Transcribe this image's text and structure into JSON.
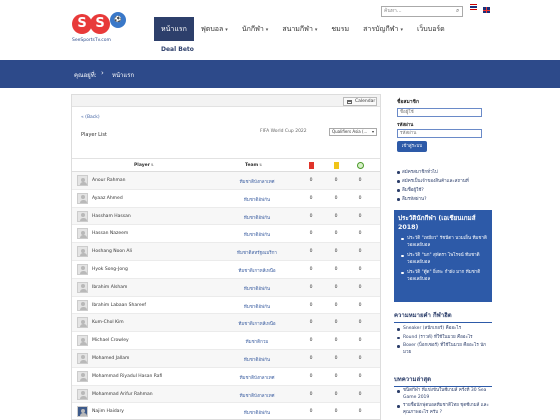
{
  "header": {
    "logo": {
      "letters": [
        "S",
        "S"
      ],
      "tagline": "SeeSportsTv.com"
    },
    "nav": [
      {
        "label": "หน้าแรก",
        "active": true,
        "dropdown": false
      },
      {
        "label": "ฟุตบอล",
        "active": false,
        "dropdown": true
      },
      {
        "label": "นักกีฬา",
        "active": false,
        "dropdown": true
      },
      {
        "label": "สนามกีฬา",
        "active": false,
        "dropdown": true
      },
      {
        "label": "ชมรม",
        "active": false,
        "dropdown": false
      },
      {
        "label": "สารบัญกีฬา",
        "active": false,
        "dropdown": true
      },
      {
        "label": "เว็บบอร์ด",
        "active": false,
        "dropdown": false
      }
    ],
    "subnav": "Deal Beto",
    "search_placeholder": "ค้นหา..."
  },
  "breadcrumb": {
    "label": "คุณอยู่ที่:",
    "page": "หน้าแรก"
  },
  "main": {
    "calendar_label": "Calendar",
    "back_link": "« (Back)",
    "player_title": "Player List",
    "tournament": "FIFA World Cup 2022",
    "stage_select": "Qualifiers Asia (...",
    "columns": {
      "player": "Player",
      "team": "Team"
    },
    "players": [
      {
        "name": "Anour Rahman",
        "team": "ทีมชาติบังกลาเทศ",
        "red": 0,
        "yellow": 0,
        "goals": 0
      },
      {
        "name": "Ayaaz Ahmed",
        "team": "ทีมชาติอัฟกัน",
        "red": 0,
        "yellow": 0,
        "goals": 0
      },
      {
        "name": "Hassham Hassan",
        "team": "ทีมชาติอัฟกัน",
        "red": 0,
        "yellow": 0,
        "goals": 0
      },
      {
        "name": "Hassan Nazeem",
        "team": "ทีมชาติอัฟกัน",
        "red": 0,
        "yellow": 0,
        "goals": 0
      },
      {
        "name": "Hoshang Noon Ali",
        "team": "ทีมชาติสหรัฐอเมริกา",
        "red": 0,
        "yellow": 0,
        "goals": 0
      },
      {
        "name": "Hyok Song-Jong",
        "team": "ทีมชาติเกาหลีเหนือ",
        "red": 0,
        "yellow": 0,
        "goals": 0
      },
      {
        "name": "Ibrahim Alsham",
        "team": "ทีมชาติอัฟกัน",
        "red": 0,
        "yellow": 0,
        "goals": 0
      },
      {
        "name": "Ibrahim Labaan Shareef",
        "team": "ทีมชาติอัฟกัน",
        "red": 0,
        "yellow": 0,
        "goals": 0
      },
      {
        "name": "Kum-Chol Kim",
        "team": "ทีมชาติเกาหลีเหนือ",
        "red": 0,
        "yellow": 0,
        "goals": 0
      },
      {
        "name": "Michael Crowley",
        "team": "ทีมชาติกวม",
        "red": 0,
        "yellow": 0,
        "goals": 0
      },
      {
        "name": "Mohamed Jallam",
        "team": "ทีมชาติอัฟกัน",
        "red": 0,
        "yellow": 0,
        "goals": 0
      },
      {
        "name": "Mohammad Riyadul Hasan Rafi",
        "team": "ทีมชาติบังกลาเทศ",
        "red": 0,
        "yellow": 0,
        "goals": 0
      },
      {
        "name": "Mohammad Arifur Rahman",
        "team": "ทีมชาติบังกลาเทศ",
        "red": 0,
        "yellow": 0,
        "goals": 0
      },
      {
        "name": "Najim Haidary",
        "team": "ทีมชาติอัฟกัน",
        "red": 0,
        "yellow": 0,
        "goals": 0
      }
    ]
  },
  "sidebar": {
    "login_title": "ชื่อสมาชิก",
    "username_placeholder": "ชื่อผู้ใช้",
    "password_label": "รหัสผ่าน",
    "password_placeholder": "รหัสผ่าน",
    "login_button": "เข้าสู่ระบบ",
    "links": [
      "สมัครสมาชิกทั่วไป",
      "สมัครเป็นเจ้าของสินค้าและสถานที่",
      "ลืมชื่อผู้ใช้?",
      "ลืมรหัสผ่าน?"
    ],
    "promo": {
      "title": "ประวัตินักกีฬา (เอเชียนเกมส์ 2018)",
      "items": [
        "ประวัติ \"เหมียว\" รัชนีดา นวมเย็น ทีมชาติวอลเลย์บอล",
        "ประวัติ \"นก\" สุพัตรา ไพโรจน์ ทีมชาติวอลเลย์บอล",
        "ประวัติ \"ตู๊ด\" ยิ่งหะ กำผัง มาก ทีมชาติวอลเลย์บอล"
      ]
    },
    "section1": {
      "title": "ความหมายคำ กีฬาฮิต",
      "items": [
        "Sneaker (สนีกเกอร์) คืออะไร",
        "Round (ราวด์) ที่ใช้ในมวย คืออะไร",
        "Boxer (บ็อกเซอร์) ที่ใช้ในมวย คืออะไร นักมวย"
      ]
    },
    "section2": {
      "title": "บทความล่าสุด",
      "items": [
        "ชนิดกีฬา ที่แข่งขันในซีเกมส์ ครั้งที่ 30 Sea Game 2019",
        "รายชื่อนักฟุตบอลทีมชาติไทย ชุดซีเกมส์ และคุณภาพอะไร ครับ ?"
      ]
    }
  },
  "colors": {
    "nav_active": "#2d3f6b",
    "breadcrumb_bar": "#2d4a8a",
    "promo_box": "#2d5aa8",
    "logo_red": "#e83a3a"
  }
}
